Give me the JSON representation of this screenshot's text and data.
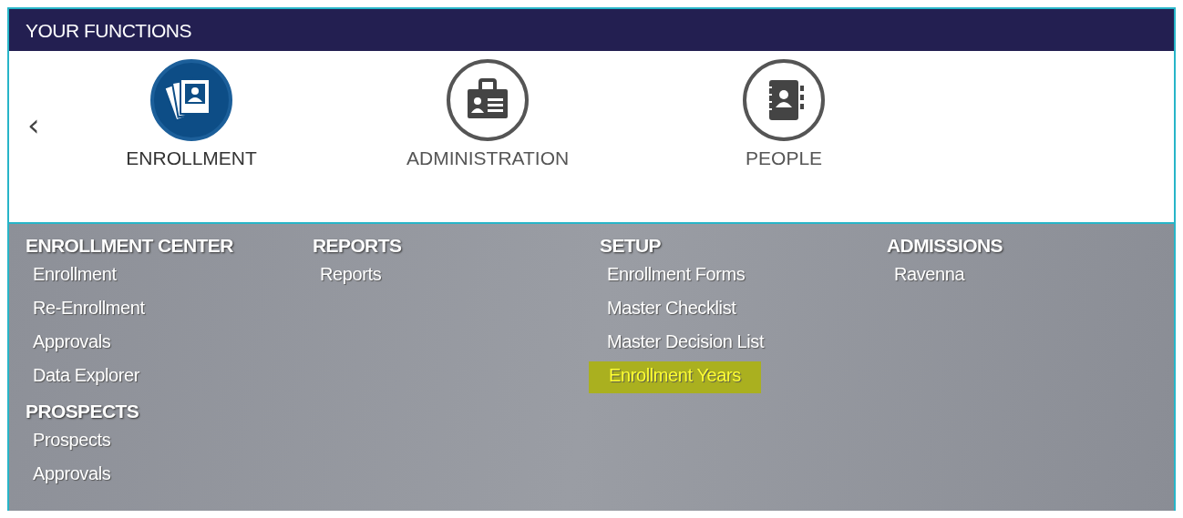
{
  "header": {
    "title": "YOUR FUNCTIONS"
  },
  "carousel": {
    "prev": "‹"
  },
  "functions": [
    {
      "label": "ENROLLMENT",
      "kind": "enrollment",
      "selected": true
    },
    {
      "label": "ADMINISTRATION",
      "kind": "administration",
      "selected": false
    },
    {
      "label": "PEOPLE",
      "kind": "people",
      "selected": false
    }
  ],
  "menu": {
    "columns": [
      {
        "sections": [
          {
            "heading": "ENROLLMENT CENTER",
            "items": [
              {
                "label": "Enrollment",
                "highlighted": false
              },
              {
                "label": "Re-Enrollment",
                "highlighted": false
              },
              {
                "label": "Approvals",
                "highlighted": false
              },
              {
                "label": "Data Explorer",
                "highlighted": false
              }
            ]
          },
          {
            "heading": "PROSPECTS",
            "items": [
              {
                "label": "Prospects",
                "highlighted": false
              },
              {
                "label": "Approvals",
                "highlighted": false
              }
            ]
          }
        ]
      },
      {
        "sections": [
          {
            "heading": "REPORTS",
            "items": [
              {
                "label": "Reports",
                "highlighted": false
              }
            ]
          }
        ]
      },
      {
        "sections": [
          {
            "heading": "SETUP",
            "items": [
              {
                "label": "Enrollment Forms",
                "highlighted": false
              },
              {
                "label": "Master Checklist",
                "highlighted": false
              },
              {
                "label": "Master Decision List",
                "highlighted": false
              },
              {
                "label": "Enrollment Years",
                "highlighted": true
              }
            ]
          }
        ]
      },
      {
        "sections": [
          {
            "heading": "ADMISSIONS",
            "items": [
              {
                "label": "Ravenna",
                "highlighted": false
              }
            ]
          }
        ]
      }
    ]
  }
}
